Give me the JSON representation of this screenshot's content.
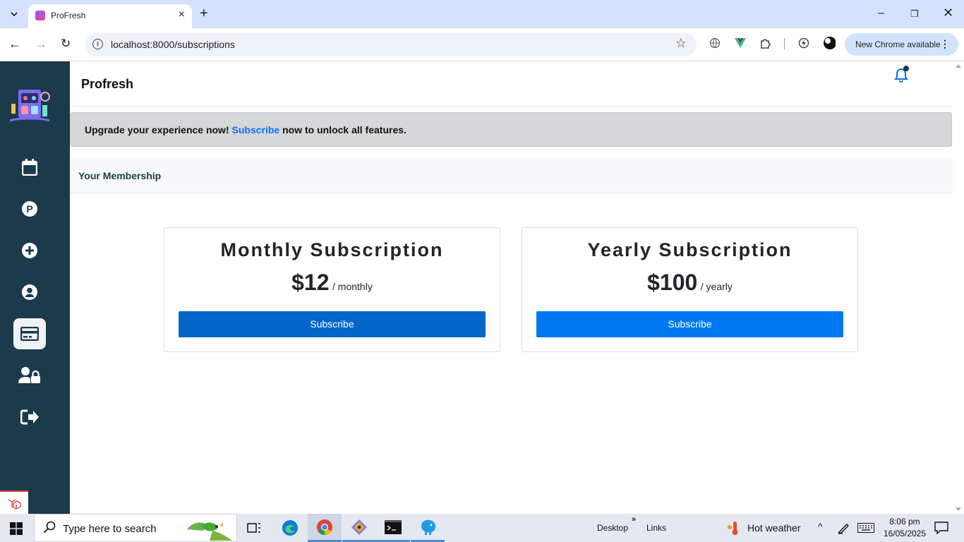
{
  "browser": {
    "tab_title": "ProFresh",
    "url": "localhost:8000/subscriptions",
    "update_label": "New Chrome available"
  },
  "app": {
    "brand": "Profresh",
    "alert": {
      "prefix": "Upgrade your experience now!",
      "link": "Subscribe",
      "suffix": "now to unlock all features."
    },
    "section_title": "Your Membership",
    "sidebar": {
      "items": [
        {
          "icon": "calendar-icon",
          "active": false
        },
        {
          "icon": "parking-p-icon",
          "active": false
        },
        {
          "icon": "add-circle-icon",
          "active": false
        },
        {
          "icon": "user-circle-icon",
          "active": false
        },
        {
          "icon": "credit-card-icon",
          "active": true
        },
        {
          "icon": "user-lock-icon",
          "active": false
        },
        {
          "icon": "logout-icon",
          "active": false
        }
      ]
    },
    "plans": [
      {
        "name": "Monthly Subscription",
        "price": "$12",
        "period": "/ monthly",
        "button": "Subscribe",
        "button_color": "#0466c8"
      },
      {
        "name": "Yearly Subscription",
        "price": "$100",
        "period": "/ yearly",
        "button": "Subscribe",
        "button_color": "#0078f2"
      }
    ]
  },
  "taskbar": {
    "search_placeholder": "Type here to search",
    "desktop_label": "Desktop",
    "links_label": "Links",
    "weather": "Hot weather",
    "time": "8:06 pm",
    "date": "16/05/2025"
  },
  "colors": {
    "sidebar": "#1b3a4b",
    "accent": "#0d6efd",
    "alert_bg": "#d6d7d9"
  }
}
